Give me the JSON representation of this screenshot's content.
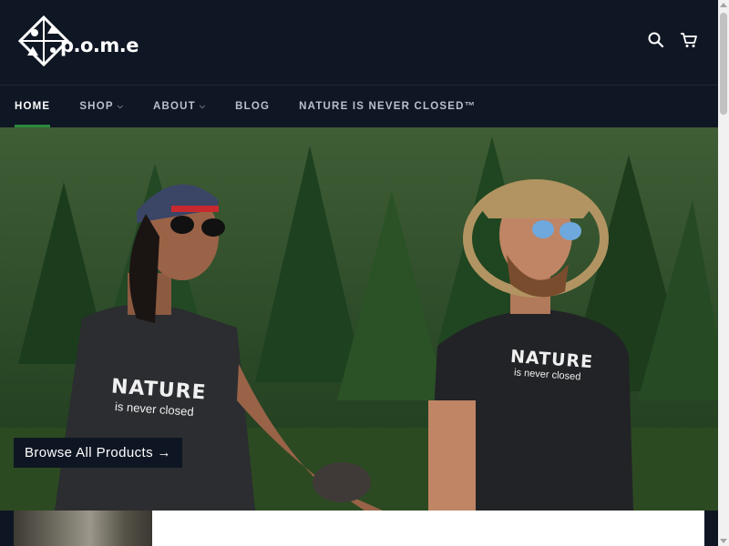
{
  "header": {
    "logo_text": "p.o.m.e",
    "icons": [
      "search-icon",
      "cart-icon"
    ]
  },
  "nav": {
    "items": [
      {
        "label": "HOME",
        "active": true
      },
      {
        "label": "SHOP",
        "dropdown": true
      },
      {
        "label": "ABOUT",
        "dropdown": true
      },
      {
        "label": "BLOG"
      },
      {
        "label": "NATURE IS NEVER CLOSED™"
      }
    ]
  },
  "hero": {
    "cta_label": "Browse All Products →",
    "shirt_left_line1": "NATURE",
    "shirt_left_line2": "is never closed",
    "shirt_right_line1": "NATURE",
    "shirt_right_line2": "is never closed"
  },
  "colors": {
    "header_bg": "#101724",
    "active_underline": "#2b8a3e",
    "cta_bg": "#0f1623"
  }
}
